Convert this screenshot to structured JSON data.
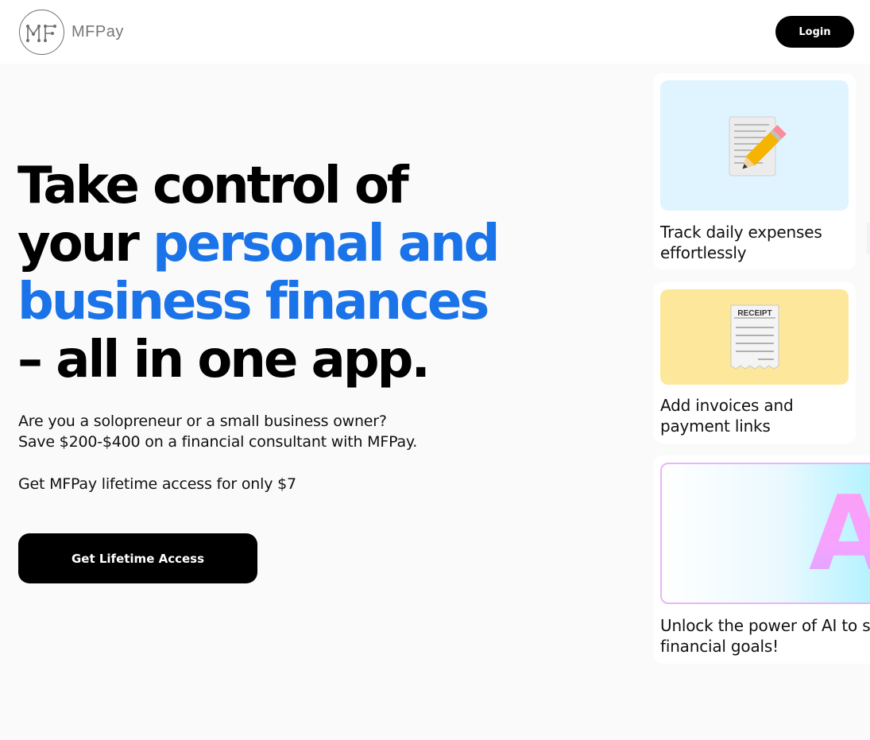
{
  "header": {
    "logo_mark": "MF",
    "logo_text": "MFPay",
    "login_label": "Login"
  },
  "hero": {
    "line1": "Take control of",
    "line2a": "your ",
    "line2b": "personal and",
    "line3": "business finances",
    "line4": "– all in one app.",
    "sub1": "Are you a solopreneur or a small business owner?",
    "sub2": "Save $200-$400 on a financial consultant with MFPay.",
    "sub3": "Get MFPay lifetime access for only $7",
    "cta_label": "Get Lifetime Access"
  },
  "features": [
    {
      "icon": "memo-pencil-icon",
      "line1": "Track daily expenses",
      "line2": "effortlessly"
    },
    {
      "icon": "receipt-icon",
      "line1": "Add invoices and",
      "line2": "payment links",
      "receipt_title": "RECEIPT"
    },
    {
      "icon": "ai-gradient-icon",
      "line1": "Unlock the power of AI to s",
      "line2": "financial goals!",
      "ai_text": "A"
    }
  ],
  "colors": {
    "accent_blue": "#1a73e8",
    "button_black": "#000000",
    "card1_bg": "#dff4ff",
    "card2_bg": "#fde79a"
  }
}
